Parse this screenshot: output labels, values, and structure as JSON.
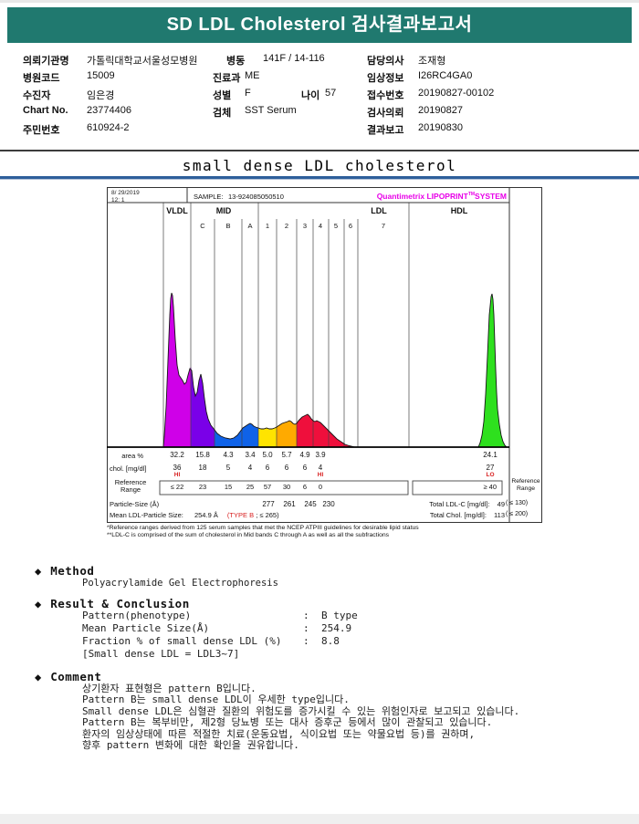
{
  "header": {
    "title": "SD LDL Cholesterol 검사결과보고서"
  },
  "patient": {
    "rows": [
      {
        "l1": "의뢰기관명",
        "v1": "가톨릭대학교서울성모병원",
        "l1b": "병동",
        "v1b": "141F / 14-116",
        "l3": "담당의사",
        "v3": "조재형"
      },
      {
        "l1": "병원코드",
        "v1": "15009",
        "l2": "진료과",
        "v2": "ME",
        "l3": "임상정보",
        "v3": "I26RC4GA0"
      },
      {
        "l1": "수진자",
        "v1": "임은경",
        "l2": "성별",
        "v2": "F",
        "l2b": "나이",
        "v2b": "57",
        "l3": "접수번호",
        "v3": "20190827-00102"
      },
      {
        "l1": "Chart No.",
        "v1": "23774406",
        "l2": "검체",
        "v2": "SST Serum",
        "l3": "검사의뢰",
        "v3": "20190827"
      },
      {
        "l1": "주민번호",
        "v1": "610924-2",
        "l3": "결과보고",
        "v3": "20190830"
      }
    ]
  },
  "section_title": "small dense LDL cholesterol",
  "lipoprint": {
    "date_line1": "8/ 29/2019",
    "date_line2": "12: 1",
    "sample_label": "SAMPLE:",
    "sample_value": "13-924085050510",
    "brand": {
      "prefix": "Quantimetrix LIPOPRINT",
      "tm": "TM",
      "suffix": "SYSTEM"
    },
    "groups": {
      "vldl": "VLDL",
      "mid": "MID",
      "ldl": "LDL",
      "hdl": "HDL"
    },
    "row_labels": {
      "area": "area %",
      "chol": "chol. [mg/dl]",
      "ref1": "Reference",
      "ref2": "Range",
      "psize": "Particle-Size (Å)",
      "mean_label": "Mean LDL-Particle Size:",
      "mean_value": "254.9 Å",
      "mean_type": "(TYPE B",
      "mean_ref": "; ≤ 265)"
    },
    "lanes": [
      {
        "sub": "",
        "area": "32.2",
        "chol": "36",
        "flag": "HI",
        "ref": "≤ 22"
      },
      {
        "sub": "C",
        "area": "15.8",
        "chol": "18",
        "ref": "23"
      },
      {
        "sub": "B",
        "area": "4.3",
        "chol": "5",
        "ref": "15"
      },
      {
        "sub": "A",
        "area": "3.4",
        "chol": "4",
        "ref": "25"
      },
      {
        "sub": "1",
        "area": "5.0",
        "chol": "6",
        "ref": "57",
        "psize": "277"
      },
      {
        "sub": "2",
        "area": "5.7",
        "chol": "6",
        "ref": "30",
        "psize": "261"
      },
      {
        "sub": "3",
        "area": "4.9",
        "chol": "6",
        "ref": "6",
        "psize": "245"
      },
      {
        "sub": "4",
        "area": "3.9",
        "chol": "4",
        "flag": "HI",
        "ref": "0",
        "psize": "230"
      },
      {
        "sub": "5"
      },
      {
        "sub": "6"
      },
      {
        "sub": "7"
      },
      {
        "sub": "",
        "area": "24.1",
        "chol": "27",
        "flag": "LO",
        "ref": "≥ 40"
      }
    ],
    "right": {
      "ref1": "Reference",
      "ref2": "Range",
      "ldl_label": "Total LDL-C [mg/dl]:",
      "ldl_value": "49",
      "ldl_ref": "( ≤ 130)",
      "chol_label": "Total Chol. [mg/dl]:",
      "chol_value": "113",
      "chol_ref": "( ≤ 200)"
    },
    "footnote1": "*Reference ranges derived from 125 serum samples that met the NCEP ATPIII guidelines for desirable lipid status",
    "footnote2": "**LDL-C is comprised of the sum of cholesterol in Mid bands C through A as well as all the subfractions"
  },
  "method": {
    "bullet": "◆",
    "title": "Method",
    "body": "Polyacrylamide Gel Electrophoresis"
  },
  "result": {
    "bullet": "◆",
    "title": "Result & Conclusion",
    "rows": [
      {
        "label": "Pattern(phenotype)",
        "colon": ":",
        "value": "B type"
      },
      {
        "label": "Mean Particle Size(Å)",
        "colon": ":",
        "value": "254.9"
      },
      {
        "label": "Fraction % of small dense LDL (%)",
        "colon": ":",
        "value": "8.8"
      }
    ],
    "note": "[Small dense LDL = LDL3~7]"
  },
  "comment": {
    "bullet": "◆",
    "title": "Comment",
    "lines": [
      "상기환자 표현형은 pattern B입니다.",
      "Pattern B는 small dense LDL이 우세한 type입니다.",
      "Small dense LDL은 심혈관 질환의 위험도를 증가시킬 수 있는 위험인자로 보고되고 있습니다.",
      "Pattern B는 복부비만, 제2형 당뇨병 또는 대사 증후군 등에서 많이 관찰되고 있습니다.",
      "환자의 임상상태에 따른 적절한 치료(운동요법, 식이요법 또는 약물요법 등)를 권하며,",
      "향후 pattern 변화에 대한 확인을 권유합니다."
    ]
  },
  "chart_data": {
    "type": "area",
    "title": "Lipoprint LDL subfraction densitometry scan",
    "lanes": [
      "VLDL",
      "MID C",
      "MID B",
      "MID A",
      "LDL1",
      "LDL2",
      "LDL3",
      "LDL4",
      "HDL"
    ],
    "area_percent": [
      32.2,
      15.8,
      4.3,
      3.4,
      5.0,
      5.7,
      4.9,
      3.9,
      24.1
    ],
    "chol_mg_dl": [
      36,
      18,
      5,
      4,
      6,
      6,
      6,
      4,
      27
    ],
    "flags": [
      "HI",
      null,
      null,
      null,
      null,
      null,
      null,
      "HI",
      "LO"
    ],
    "reference_range": [
      "≤22",
      "23",
      "15",
      "25",
      "57",
      "30",
      "6",
      "0",
      "≥40"
    ],
    "particle_size_A": {
      "LDL1": 277,
      "LDL2": 261,
      "LDL3": 245,
      "LDL4": 230
    },
    "mean_ldl_particle_size_A": 254.9,
    "mean_ldl_type": "TYPE B",
    "total_ldl_c_mg_dl": 49,
    "total_ldl_c_ref": "≤130",
    "total_chol_mg_dl": 113,
    "total_chol_ref": "≤200",
    "legend_position": "none",
    "colors": {
      "vldl": "#cf00e8",
      "midc": "#7a00e8",
      "midb_a": "#0f62e8",
      "ldl1": "#ffe400",
      "ldl2": "#ffaa00",
      "ldl3_7": "#ef0f3c",
      "hdl": "#2ee01e"
    }
  }
}
